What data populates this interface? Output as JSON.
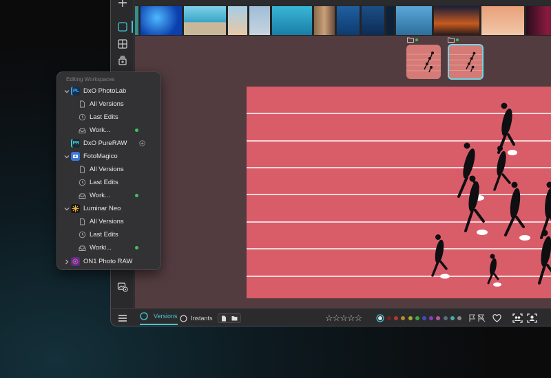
{
  "workspaces_panel": {
    "header": "Editing Workspaces",
    "apps": [
      {
        "name": "DxO PhotoLab",
        "icon": "dxo-photolab-icon",
        "items": [
          {
            "label": "All Versions",
            "icon": "document-icon"
          },
          {
            "label": "Last Edits",
            "icon": "clock-icon"
          },
          {
            "label": "Work...",
            "icon": "tray-icon",
            "status": "active"
          }
        ]
      },
      {
        "name": "DxO PureRAW",
        "icon": "dxo-pureraw-icon",
        "icon_text": "PR",
        "items": []
      },
      {
        "name": "FotoMagico",
        "icon": "fotomagico-icon",
        "items": [
          {
            "label": "All Versions",
            "icon": "document-icon"
          },
          {
            "label": "Last Edits",
            "icon": "clock-icon"
          },
          {
            "label": "Work...",
            "icon": "tray-icon",
            "status": "active"
          }
        ]
      },
      {
        "name": "Luminar Neo",
        "icon": "luminar-neo-icon",
        "items": [
          {
            "label": "All Versions",
            "icon": "document-icon"
          },
          {
            "label": "Last Edits",
            "icon": "clock-icon"
          },
          {
            "label": "Worki...",
            "icon": "tray-icon",
            "status": "active"
          }
        ]
      },
      {
        "name": "ON1 Photo RAW",
        "icon": "on1-photo-raw-icon",
        "items": []
      }
    ]
  },
  "bottom_bar": {
    "versions_label": "Versions",
    "instants_label": "Instants",
    "rating": 0,
    "max_rating": 5,
    "color_labels": [
      "#7a1f1f",
      "#b03a2e",
      "#b8862b",
      "#a9a935",
      "#3ea848",
      "#3a4fc4",
      "#8a3fb5",
      "#b05aa8",
      "#5a6f78",
      "#4aa9b2",
      "#8a8a8a"
    ]
  },
  "colors": {
    "accent": "#3fc8d8",
    "active_green": "#3ec45a",
    "track": "#d95d69"
  }
}
